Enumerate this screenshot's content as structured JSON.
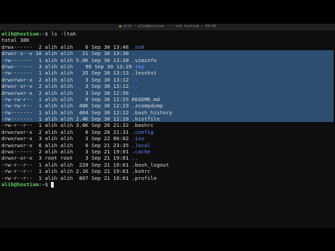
{
  "window": {
    "title": "alih — alih@hostium: ~ — ssh hostium — 91×34"
  },
  "command": {
    "user": "alih@hostium",
    "path": "~",
    "symbol": "$",
    "text": " ls -ltah"
  },
  "total": "total 38K",
  "rows": [
    {
      "meta": "drwx------  2 alih alih    6 Sep 30 13:46 ",
      "name": ".ssh",
      "dir": true,
      "sel": false
    },
    {
      "meta": "drwxr-x--x 10 alih alih   21 Sep 30 13:30 ",
      "name": ".",
      "dir": true,
      "sel": true
    },
    {
      "meta": "-rw-------  1 alih alih 5.0K Sep 30 13:30 ",
      "name": ".viminfo",
      "dir": false,
      "sel": true
    },
    {
      "meta": "drwx------  3 alih alih    98 Sep 30 13:29 ",
      "name": "tmp",
      "dir": true,
      "sel": true
    },
    {
      "meta": "-rw-------  1 alih alih   35 Sep 30 13:13 ",
      "name": ".lesshst",
      "dir": false,
      "sel": true
    },
    {
      "meta": "drwxrwxr-x  2 alih alih    3 Sep 30 13:12 ",
      "name": "..",
      "dir": true,
      "sel": true
    },
    {
      "meta": "drwxr-xr-x  2 alih alih    3 Sep 30 13:12 ",
      "name": "..",
      "dir": true,
      "sel": true
    },
    {
      "meta": "drwxrwxr-x  2 alih alih    3 Sep 30 12:56 ",
      "name": "..",
      "dir": true,
      "sel": true
    },
    {
      "meta": "-rw-rw-r--  1 alih alih    0 Sep 30 12:55 ",
      "name": "README.md",
      "dir": false,
      "sel": true
    },
    {
      "meta": "-rw-rw-r--  1 alih alih  48K Sep 30 12:23 ",
      "name": ".zcompdump",
      "dir": false,
      "sel": true
    },
    {
      "meta": "-rw-------  1 alih alih  464 Sep 30 12:22 ",
      "name": ".bash_history",
      "dir": false,
      "sel": true
    },
    {
      "meta": "-rw-------  1 alih alih 2.4K Sep 30 12:20 ",
      "name": ".histfile",
      "dir": false,
      "sel": true
    },
    {
      "meta": "-rw-r--r--  1 alih alih 3.8K Sep 26 21:32 ",
      "name": ".bashrc",
      "dir": false,
      "sel": false
    },
    {
      "meta": "drwxrwxr-x  2 alih alih    6 Sep 26 21:31 ",
      "name": ".config",
      "dir": true,
      "sel": false
    },
    {
      "meta": "drwxrwxr-x  3 alih alih    3 Sep 22 00:02 ",
      "name": ".iso",
      "dir": true,
      "sel": false
    },
    {
      "meta": "drwxrwxr-x  6 alih alih    6 Sep 21 23:35 ",
      "name": ".local",
      "dir": true,
      "sel": false
    },
    {
      "meta": "drwx------  2 alih alih    3 Sep 21 19:01 ",
      "name": ".cache",
      "dir": true,
      "sel": false
    },
    {
      "meta": "drwxr-xr-x  3 root root    3 Sep 21 19:01 ",
      "name": "..",
      "dir": true,
      "sel": false
    },
    {
      "meta": "-rw-r--r--  1 alih alih  220 Sep 21 19:01 ",
      "name": ".bash_logout",
      "dir": false,
      "sel": false
    },
    {
      "meta": "-rw-r--r--  1 alih alih 2.1K Sep 21 19:01 ",
      "name": ".kshrc",
      "dir": false,
      "sel": false
    },
    {
      "meta": "-rw-r--r--  1 alih alih  807 Sep 21 19:01 ",
      "name": ".profile",
      "dir": false,
      "sel": false
    }
  ],
  "prompt2": {
    "user": "alih@hostium",
    "path": "~",
    "symbol": "$"
  },
  "colors": {
    "selection": "#2d4e70",
    "dir": "#5b8cff",
    "user": "#5fd35f",
    "path": "#6f8fff"
  }
}
